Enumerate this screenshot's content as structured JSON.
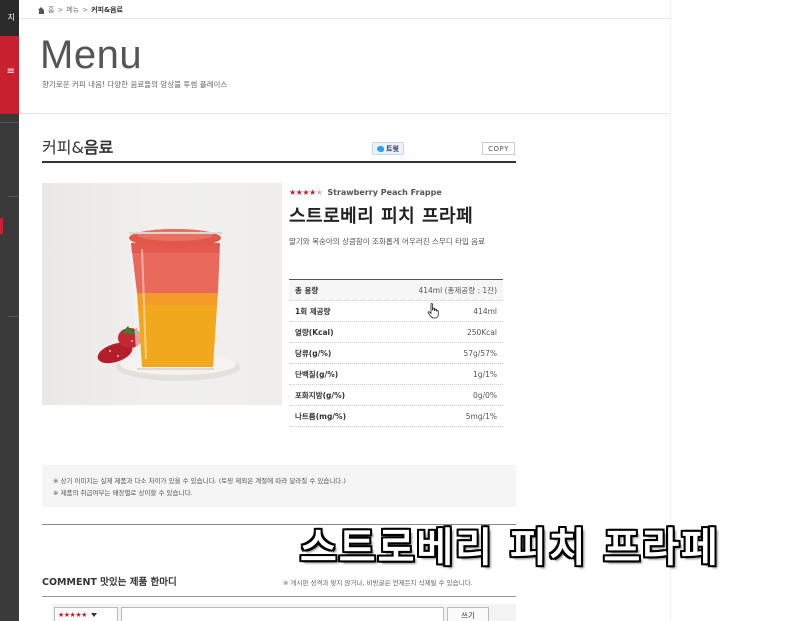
{
  "sidebar": {
    "top_label": "지",
    "menu_icon": "menu-icon"
  },
  "breadcrumb": {
    "home_icon": "home-icon",
    "items": [
      "홈",
      "메뉴",
      "커피&음료"
    ]
  },
  "header": {
    "title": "Menu",
    "subtitle": "향기로운 커피 내음! 다양한 음료들의 앙상블 투썸 플레이스"
  },
  "section": {
    "title_light": "커피&",
    "title_bold": "음료",
    "tweet_label": "트윗",
    "copy_label": "COPY"
  },
  "product": {
    "rating": 4,
    "rating_max": 5,
    "name_en": "Strawberry Peach Frappe",
    "name_ko": "스트로베리 피치 프라페",
    "description": "딸기와 복숭아의 상큼함이 조화롭게 어우러진 스무디 타입 음료",
    "nutrition": [
      {
        "label": "총 용량",
        "value": "414ml (총제공량 : 1잔)"
      },
      {
        "label": "1회 제공량",
        "value": "414ml"
      },
      {
        "label": "열량(Kcal)",
        "value": "250Kcal"
      },
      {
        "label": "당류(g/%)",
        "value": "57g/57%"
      },
      {
        "label": "단백질(g/%)",
        "value": "1g/1%"
      },
      {
        "label": "포화지방(g/%)",
        "value": "0g/0%"
      },
      {
        "label": "나트륨(mg/%)",
        "value": "5mg/1%"
      }
    ]
  },
  "notice": {
    "line1": "※ 상기 이미지는 실제 제품과 다소 차이가 있을 수 있습니다. (토핑 제외은 계절에 따라 달라질 수 있습니다.)",
    "line2": "※ 제품의 취급여부는 매장별로 상이할 수 있습니다."
  },
  "overlay_caption": "스트로베리 피치 프라페",
  "comment": {
    "title": "COMMENT 맛있는 제품 한마디",
    "note": "※ 게시판 성격과 맞지 않거나, 비방글은 언제든지 삭제될 수 있습니다.",
    "rating_stars": "★★★★★",
    "write_label": "쓰기"
  },
  "colors": {
    "accent": "#c8202e",
    "sidebar": "#3a3a3a"
  }
}
